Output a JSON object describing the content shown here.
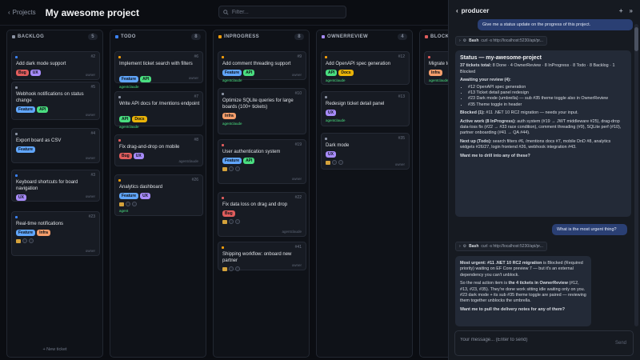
{
  "header": {
    "back": "Projects",
    "title": "My awesome project",
    "filter_placeholder": "Filter..."
  },
  "columns": [
    {
      "label": "BACKLOG",
      "count": "5",
      "color": "#8b93a3",
      "new_ticket": "+ New ticket",
      "cards": [
        {
          "num": "#2",
          "title": "Add dark mode support",
          "prio": "#3b82f6",
          "tags": [
            [
              "Bug",
              "#e05d5d"
            ],
            [
              "UX",
              "#a78bfa"
            ]
          ],
          "owner": "owner"
        },
        {
          "num": "#5",
          "title": "Webhook notifications on status change",
          "prio": "#8b93a3",
          "tags": [
            [
              "Feature",
              "#60a5fa"
            ],
            [
              "API",
              "#4ade80"
            ]
          ],
          "owner": "owner"
        },
        {
          "num": "#4",
          "title": "Export board as CSV",
          "prio": "#8b93a3",
          "tags": [
            [
              "Feature",
              "#60a5fa"
            ]
          ],
          "owner": "owner"
        },
        {
          "num": "#3",
          "title": "Keyboard shortcuts for board navigation",
          "prio": "#3b82f6",
          "tags": [
            [
              "UX",
              "#a78bfa"
            ]
          ],
          "owner": "owner"
        },
        {
          "num": "#23",
          "title": "Real-time notifications",
          "prio": "#3b82f6",
          "tags": [
            [
              "Feature",
              "#60a5fa"
            ],
            [
              "Infra",
              "#f59e6b"
            ]
          ],
          "owner": "owner",
          "icons": "1"
        }
      ]
    },
    {
      "label": "TODO",
      "count": "8",
      "color": "#3b82f6",
      "cards": [
        {
          "num": "#6",
          "title": "Implement ticket search with filters",
          "prio": "#f59e0b",
          "tags": [
            [
              "Feature",
              "#60a5fa"
            ],
            [
              "API",
              "#4ade80"
            ]
          ],
          "owner": "owner",
          "agent": "agentclaude"
        },
        {
          "num": "#7",
          "title": "Write API docs for /mentions endpoint",
          "prio": "#8b93a3",
          "tags": [
            [
              "API",
              "#4ade80"
            ],
            [
              "Docs",
              "#eab308"
            ]
          ],
          "owner": "",
          "agent": "agentclaude"
        },
        {
          "num": "#8",
          "title": "Fix drag-and-drop on mobile",
          "prio": "#e05d5d",
          "tags": [
            [
              "Bug",
              "#e05d5d"
            ],
            [
              "UX",
              "#a78bfa"
            ]
          ],
          "owner": "agentclaude"
        },
        {
          "num": "#26",
          "title": "Analytics dashboard",
          "prio": "#f59e0b",
          "tags": [
            [
              "Feature",
              "#60a5fa"
            ],
            [
              "UX",
              "#a78bfa"
            ]
          ],
          "owner": "",
          "icons": "1",
          "agent": "agent"
        }
      ]
    },
    {
      "label": "INPROGRESS",
      "count": "8",
      "color": "#f59e0b",
      "cards": [
        {
          "num": "#9",
          "title": "Add comment threading support",
          "prio": "#f59e0b",
          "tags": [
            [
              "Feature",
              "#60a5fa"
            ],
            [
              "API",
              "#4ade80"
            ]
          ],
          "owner": "owner",
          "agent": "agentclaude"
        },
        {
          "num": "#10",
          "title": "Optimize SQLite queries for large boards (100+ tickets)",
          "prio": "#8b93a3",
          "tags": [
            [
              "Infra",
              "#f59e6b"
            ]
          ],
          "owner": "",
          "agent": "agentclaude"
        },
        {
          "num": "#19",
          "title": "User authentication system",
          "prio": "#e05d5d",
          "tags": [
            [
              "Feature",
              "#60a5fa"
            ],
            [
              "API",
              "#4ade80"
            ]
          ],
          "owner": "owner",
          "icons": "1"
        },
        {
          "num": "#22",
          "title": "Fix data loss on drag and drop",
          "prio": "#e05d5d",
          "tags": [
            [
              "Bug",
              "#e05d5d"
            ]
          ],
          "owner": "agentclaude",
          "icons": "1"
        },
        {
          "num": "#41",
          "title": "Shipping workflow: onboard new partner",
          "prio": "#f59e0b",
          "tags": [],
          "owner": "owner",
          "icons": "1"
        }
      ]
    },
    {
      "label": "OWNERREVIEW",
      "count": "4",
      "color": "#a78bfa",
      "cards": [
        {
          "num": "#12",
          "title": "Add OpenAPI spec generation",
          "prio": "#f59e0b",
          "tags": [
            [
              "API",
              "#4ade80"
            ],
            [
              "Docs",
              "#eab308"
            ]
          ],
          "owner": "",
          "agent": "agentclaude"
        },
        {
          "num": "#13",
          "title": "Redesign ticket detail panel",
          "prio": "#8b93a3",
          "tags": [
            [
              "UX",
              "#a78bfa"
            ]
          ],
          "owner": "",
          "agent": "agentclaude"
        },
        {
          "num": "#35",
          "title": "Dark mode",
          "prio": "#8b93a3",
          "tags": [
            [
              "UX",
              "#a78bfa"
            ]
          ],
          "owner": "owner",
          "icons": "1"
        }
      ]
    },
    {
      "label": "BLOCKED",
      "count": "1",
      "color": "#e05d5d",
      "cards": [
        {
          "num": "#11",
          "title": "Migrate to .NET",
          "prio": "#e05d5d",
          "tags": [
            [
              "Infra",
              "#f59e6b"
            ]
          ],
          "owner": "",
          "agent": "agentclaude"
        }
      ]
    }
  ],
  "panel": {
    "title": "producer",
    "plus": "+",
    "collapse": "»",
    "user_msg1": "Give me a status update on the progress of this project.",
    "tool1_name": "Bash",
    "tool1_cmd": "curl -s http://localhost:5230/api/pr...",
    "a1": {
      "heading": "Status — my-awesome-project",
      "total_b": "37 tickets total:",
      "total": " 8 Done · 4 OwnerReview · 8 InProgress · 8 Todo · 8 Backlog · 1 Blocked",
      "await_h": "Awaiting your review (4):",
      "await": [
        "#12 OpenAPI spec generation",
        "#13 Ticket detail panel redesign",
        "#23 Dark mode (umbrella) — sub #35 theme toggle also in OwnerReview",
        "#35 Theme toggle in header"
      ],
      "blocked_b": "Blocked (1):",
      "blocked": " #11 .NET 10 RC2 migration — needs your input.",
      "active_b": "Active work (8 InProgress):",
      "active": " auth system (#19 → JWT middleware #25), drag-drop data-loss fix (#22 → #33 race condition), comment threading (#9), SQLite perf (#10), partner onboarding (#41 → QA #44).",
      "next_b": "Next up (Todo):",
      "next": " search filters #6, /mentions docs #7, mobile DnD #8, analytics widgets #26/27, login frontend #26, webhook integration #43.",
      "ask": "Want me to drill into any of these?"
    },
    "user_msg2": "What is the most urgent thing?",
    "tool2_name": "Bash",
    "tool2_cmd": "curl -s http://localhost:5230/api/pr...",
    "a2": {
      "urg_b": "Most urgent: #11 .NET 10 RC2 migration",
      "urg": " is Blocked (Required priority) waiting on EF Core preview 7 — but it's an external dependency you can't unblock.",
      "p2a": "So the real action item is ",
      "p2b": "the 4 tickets in OwnerReview",
      "p2c": " (#12, #13, #23, #35). They're done work sitting idle waiting only on you. #23 dark mode + its sub #35 theme toggle are paired — reviewing them together unblocks the umbrella.",
      "ask_b": "Want me to pull the delivery notes for any of them?"
    },
    "composer_placeholder": "Your message... (Enter to send)",
    "send": "Send"
  }
}
